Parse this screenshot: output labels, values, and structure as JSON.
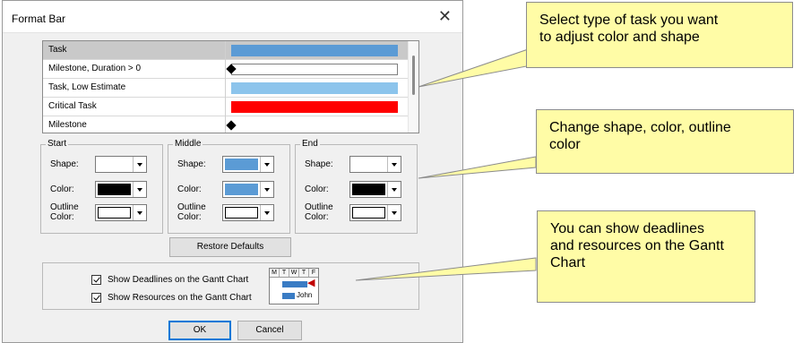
{
  "dialog": {
    "title": "Format Bar",
    "close_glyph": "✕",
    "task_list": [
      {
        "label": "Task",
        "selected": true,
        "preview": "bar",
        "color": "#5b9bd5"
      },
      {
        "label": "Milestone, Duration > 0",
        "selected": false,
        "preview": "diamond-outline-bar",
        "color": "#ffffff"
      },
      {
        "label": "Task, Low Estimate",
        "selected": false,
        "preview": "bar",
        "color": "#8cc4ec"
      },
      {
        "label": "Critical Task",
        "selected": false,
        "preview": "bar",
        "color": "#ff0000"
      },
      {
        "label": "Milestone",
        "selected": false,
        "preview": "diamond",
        "color": "#000000"
      }
    ],
    "groups": {
      "start": {
        "title": "Start",
        "shape_label": "Shape:",
        "color_label": "Color:",
        "outline_label_1": "Outline",
        "outline_label_2": "Color:",
        "shape_color": "#ffffff",
        "color": "#000000",
        "outline_color": "#ffffff"
      },
      "middle": {
        "title": "Middle",
        "shape_label": "Shape:",
        "color_label": "Color:",
        "outline_label_1": "Outline",
        "outline_label_2": "Color:",
        "shape_color": "#5b9bd5",
        "color": "#5b9bd5",
        "outline_color": "#ffffff"
      },
      "end": {
        "title": "End",
        "shape_label": "Shape:",
        "color_label": "Color:",
        "outline_label_1": "Outline",
        "outline_label_2": "Color:",
        "shape_color": "#ffffff",
        "color": "#000000",
        "outline_color": "#ffffff"
      }
    },
    "restore_defaults": "Restore Defaults",
    "options": {
      "deadlines_label": "Show Deadlines on the Gantt Chart",
      "resources_label": "Show Resources on the Gantt Chart",
      "deadlines_checked": true,
      "resources_checked": true,
      "mini_days": [
        "M",
        "T",
        "W",
        "T",
        "F"
      ],
      "mini_resource": "John"
    },
    "ok": "OK",
    "cancel": "Cancel"
  },
  "callouts": [
    {
      "line1": "Select type of task you want",
      "line2": "to adjust color and shape"
    },
    {
      "line1": "Change shape, color, outline",
      "line2": "color"
    },
    {
      "line1": "You can show deadlines",
      "line2": "and resources on the Gantt",
      "line3": "Chart"
    }
  ]
}
